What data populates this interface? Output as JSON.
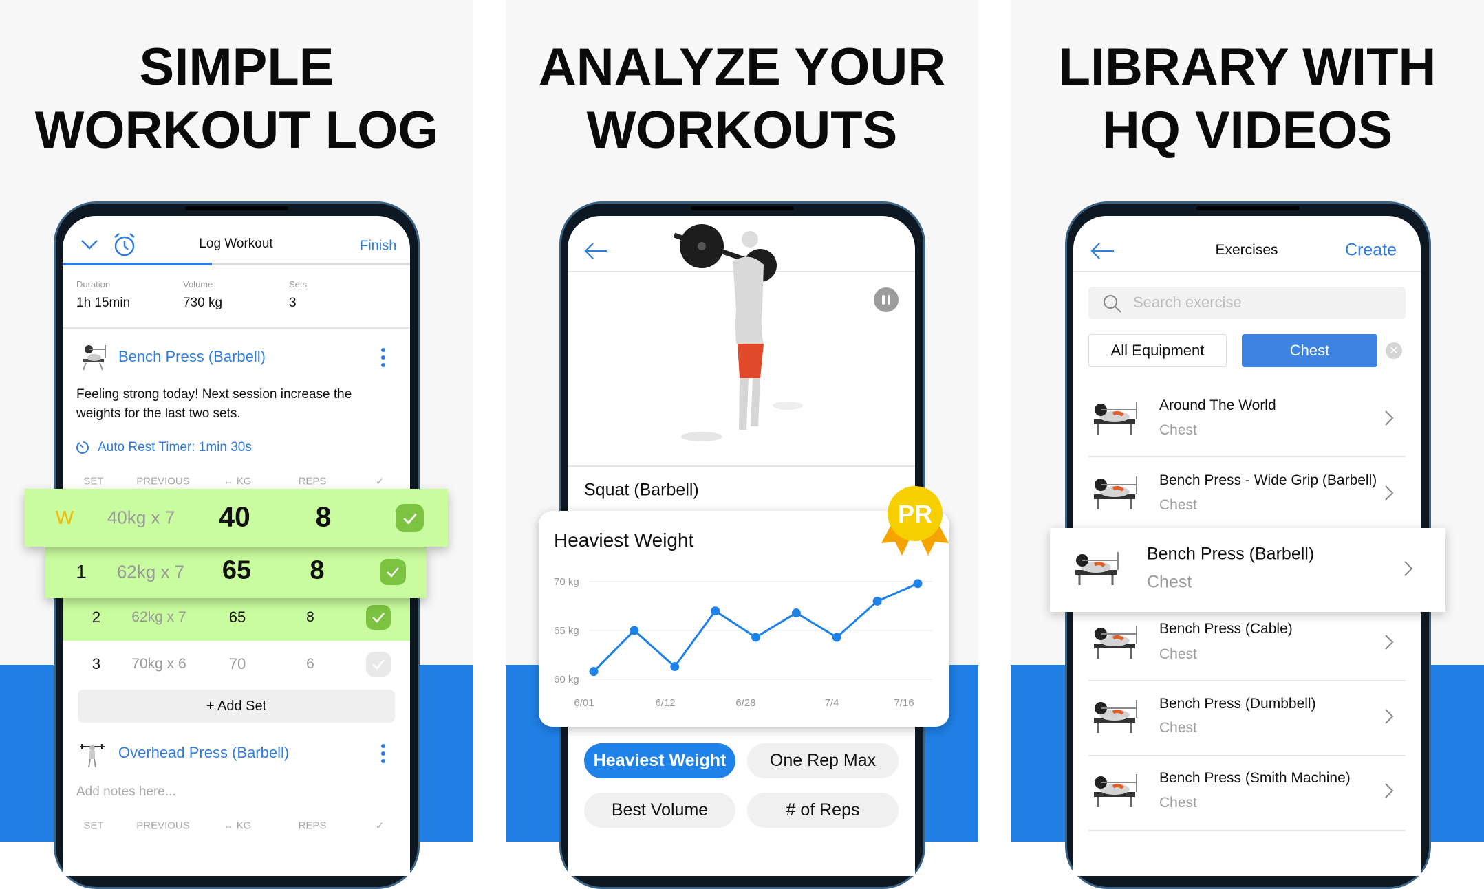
{
  "colors": {
    "accent": "#1f7fe5",
    "link": "#2f7de1",
    "completed_row": "#c9fc9e",
    "check_done": "#7cc341",
    "warmup": "#f5b800",
    "pr_badge": "#f5cf00"
  },
  "panels": [
    {
      "heading_line1": "SIMPLE",
      "heading_line2": "WORKOUT LOG"
    },
    {
      "heading_line1": "ANALYZE YOUR",
      "heading_line2": "WORKOUTS"
    },
    {
      "heading_line1": "LIBRARY WITH",
      "heading_line2": "HQ VIDEOS"
    }
  ],
  "log": {
    "title": "Log Workout",
    "finish": "Finish",
    "progress": 0.43,
    "stats": [
      {
        "label": "Duration",
        "value": "1h 15min"
      },
      {
        "label": "Volume",
        "value": "730 kg"
      },
      {
        "label": "Sets",
        "value": "3"
      }
    ],
    "exercise1": {
      "name": "Bench Press (Barbell)",
      "note": "Feeling strong today! Next session increase the weights for the last two sets.",
      "note_line1": "Feeling strong today! Next session increase the",
      "note_line2": "weights for the last two sets.",
      "rest_timer": "Auto Rest Timer: 1min 30s"
    },
    "columns": {
      "set": "SET",
      "previous": "PREVIOUS",
      "kg": "KG",
      "reps": "REPS"
    },
    "sets": [
      {
        "set": "W",
        "previous": "40kg x 7",
        "kg": "40",
        "reps": "8",
        "done": true
      },
      {
        "set": "1",
        "previous": "62kg x 7",
        "kg": "65",
        "reps": "8",
        "done": true
      },
      {
        "set": "2",
        "previous": "62kg x 7",
        "kg": "65",
        "reps": "8",
        "done": true
      },
      {
        "set": "3",
        "previous": "70kg x 6",
        "kg": "70",
        "reps": "6",
        "done": false
      }
    ],
    "add_set": "+ Add Set",
    "exercise2": {
      "name": "Overhead Press (Barbell)",
      "notes_placeholder": "Add notes here..."
    }
  },
  "analyze": {
    "exercise": "Squat (Barbell)",
    "card_title": "Heaviest Weight",
    "badge": "PR",
    "chips": [
      "Heaviest Weight",
      "One Rep Max",
      "Best Volume",
      "# of Reps"
    ],
    "active_chip": "Heaviest Weight"
  },
  "chart_data": {
    "type": "line",
    "title": "Heaviest Weight",
    "values": [
      60.8,
      65.0,
      61.3,
      67.0,
      64.3,
      66.8,
      64.3,
      68.0,
      69.8
    ],
    "x_tick_labels": [
      "6/01",
      "6/12",
      "6/28",
      "7/4",
      "7/16"
    ],
    "y_ticks": [
      {
        "v": 70,
        "label": "70 kg"
      },
      {
        "v": 65,
        "label": "65 kg"
      },
      {
        "v": 60,
        "label": "60 kg"
      }
    ],
    "ylim": [
      60,
      70
    ],
    "grid": true,
    "color": "#1e82e8"
  },
  "library": {
    "title": "Exercises",
    "create": "Create",
    "search_placeholder": "Search exercise",
    "filter_equipment": "All Equipment",
    "filter_muscle": "Chest",
    "items": [
      {
        "name": "Around The World",
        "muscle": "Chest"
      },
      {
        "name": "Bench Press - Wide Grip (Barbell)",
        "muscle": "Chest"
      },
      {
        "name": "Bench Press (Barbell)",
        "muscle": "Chest"
      },
      {
        "name": "Bench Press (Cable)",
        "muscle": "Chest"
      },
      {
        "name": "Bench Press (Dumbbell)",
        "muscle": "Chest"
      },
      {
        "name": "Bench Press (Smith Machine)",
        "muscle": "Chest"
      }
    ]
  }
}
